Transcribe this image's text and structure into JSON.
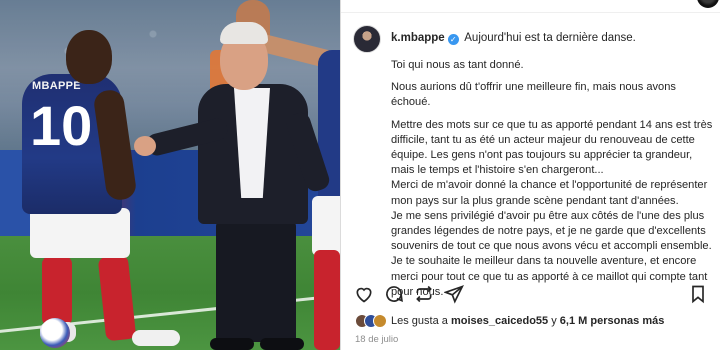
{
  "post": {
    "image_alt": "Mbappé and Deschamps celebrating on the pitch",
    "jersey_name": "MBAPPE",
    "jersey_number": "10"
  },
  "caption": {
    "username": "k.mbappe",
    "verified_icon": "verified-badge-icon",
    "headline": "Aujourd'hui est ta dernière danse.",
    "lines": [
      "Toi qui nous as tant donné.",
      "Nous aurions dû t'offrir une meilleure fin, mais nous avons échoué.",
      "Mettre des mots sur ce que tu as apporté pendant 14 ans est très difficile, tant tu as été un acteur majeur du renouveau de cette équipe. Les gens n'ont pas toujours su apprécier ta grandeur, mais le temps et l'histoire s'en chargeront...",
      "Merci de m'avoir donné la chance et l'opportunité de représenter mon pays sur la plus grande scène pendant tant d'années.",
      "Je me sens privilégié d'avoir pu être aux côtés de l'une des plus grandes légendes de notre pays, et je ne garde que d'excellents souvenirs de tout ce que nous avons vécu et accompli ensemble.",
      "Je te souhaite le meilleur dans ta nouvelle aventure, et encore merci pour tout ce que tu as apporté à ce maillot qui compte tant pour nous."
    ]
  },
  "actions": {
    "like_icon": "heart-icon",
    "comment_icon": "comment-icon",
    "share_icon": "repost-icon",
    "send_icon": "send-icon",
    "save_icon": "bookmark-icon"
  },
  "likes": {
    "prefix": "Les gusta a",
    "user": "moises_caicedo55",
    "connector": "y",
    "others": "6,1 M personas más"
  },
  "date": "18 de julio",
  "colors": {
    "verified": "#3897f0",
    "text": "#262626",
    "muted": "#8e8e8e",
    "border": "#dbdbdb"
  }
}
